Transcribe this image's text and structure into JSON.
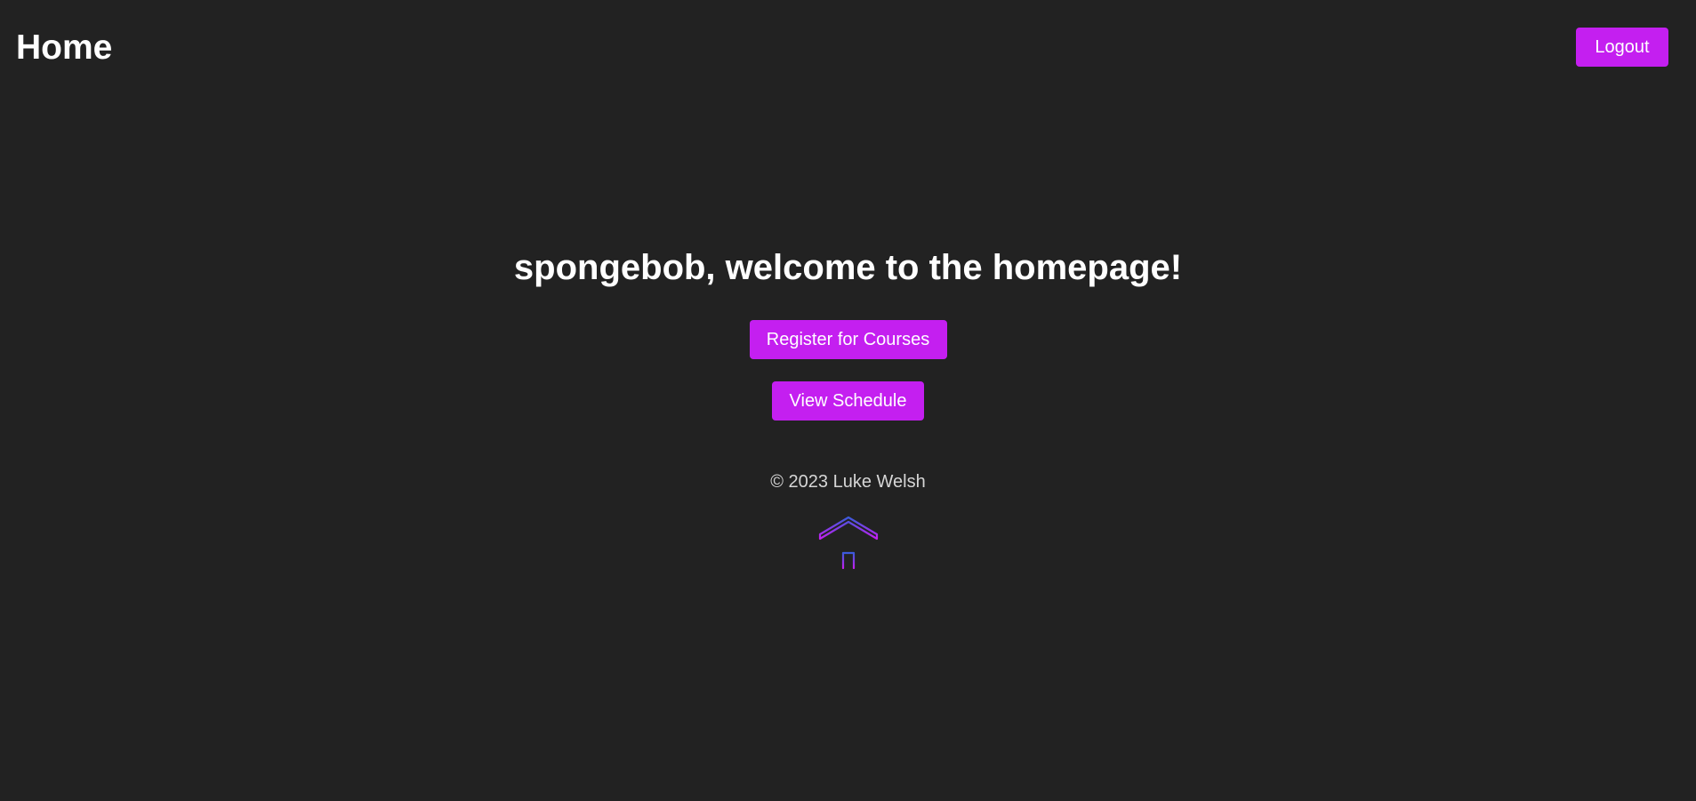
{
  "header": {
    "title": "Home",
    "logout_label": "Logout"
  },
  "main": {
    "welcome_text": "spongebob, welcome to the homepage!",
    "register_label": "Register for Courses",
    "schedule_label": "View Schedule"
  },
  "footer": {
    "copyright": "© 2023 Luke Welsh",
    "icon": "house-icon"
  },
  "colors": {
    "background": "#222222",
    "button": "#c41ff0",
    "icon_gradient_top": "#3b5bdb",
    "icon_gradient_bottom": "#c41ff0"
  }
}
